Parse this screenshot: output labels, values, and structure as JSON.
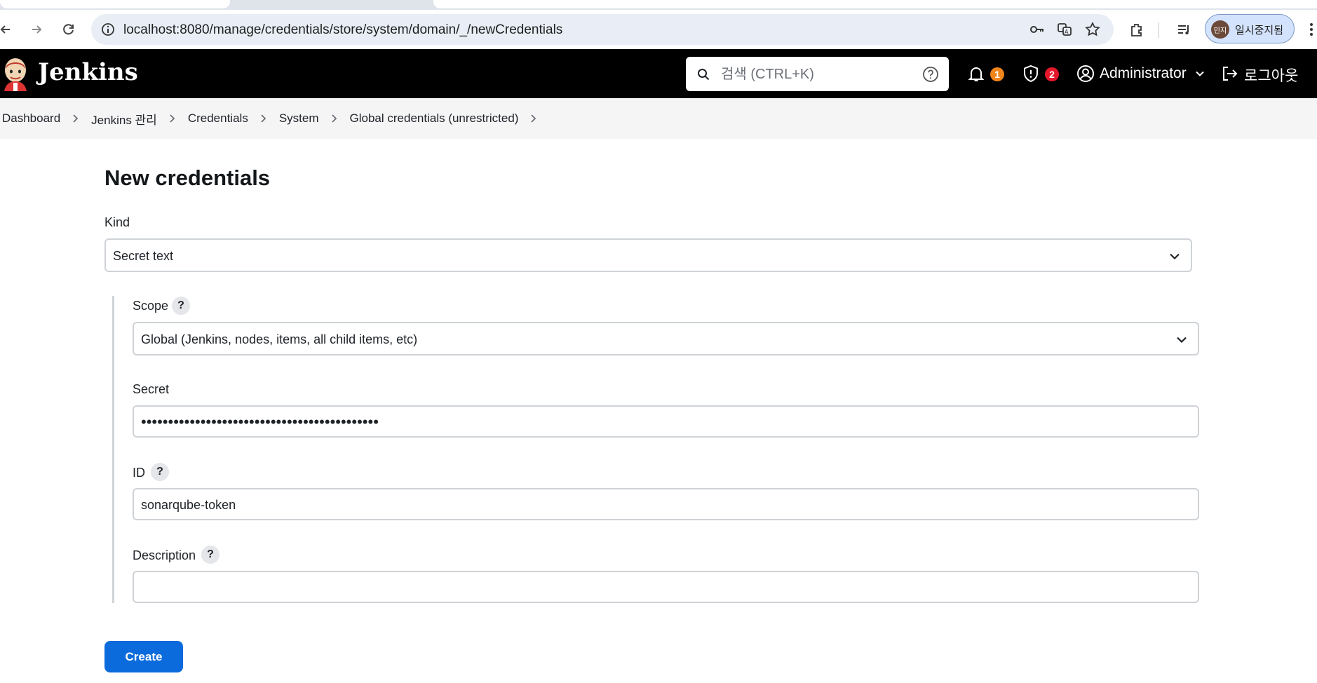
{
  "browser": {
    "url": "localhost:8080/manage/credentials/store/system/domain/_/newCredentials",
    "profile_initials": "민지",
    "profile_status": "일시중지됨"
  },
  "header": {
    "brand": "Jenkins",
    "search_placeholder": "검색 (CTRL+K)",
    "notifications_count": "1",
    "security_count": "2",
    "user_name": "Administrator",
    "logout_label": "로그아웃"
  },
  "breadcrumb": {
    "items": [
      "Dashboard",
      "Jenkins 관리",
      "Credentials",
      "System",
      "Global credentials (unrestricted)"
    ]
  },
  "page": {
    "title": "New credentials",
    "kind_label": "Kind",
    "kind_value": "Secret text",
    "scope_label": "Scope",
    "scope_value": "Global (Jenkins, nodes, items, all child items, etc)",
    "secret_label": "Secret",
    "secret_mask": "••••••••••••••••••••••••••••••••••••••••••••",
    "id_label": "ID",
    "id_value": "sonarqube-token",
    "description_label": "Description",
    "description_value": "",
    "help_glyph": "?",
    "create_label": "Create"
  },
  "colors": {
    "header_bg": "#000000",
    "breadcrumb_bg": "#f5f5f6",
    "primary_button": "#0b6bdc",
    "notification_badge": "#f0851b",
    "security_badge": "#e5172b"
  }
}
